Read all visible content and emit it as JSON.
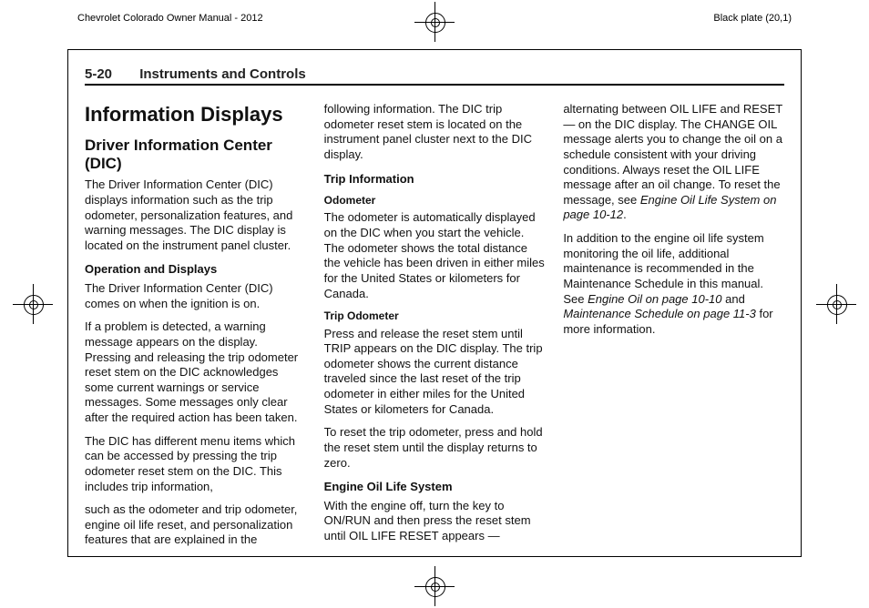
{
  "printer": {
    "left": "Chevrolet Colorado Owner Manual - 2012",
    "right": "Black plate (20,1)"
  },
  "running_head": {
    "page": "5-20",
    "section": "Instruments and Controls"
  },
  "col1": {
    "h1": "Information Displays",
    "h2": "Driver Information Center (DIC)",
    "p1": "The Driver Information Center (DIC) displays information such as the trip odometer, personalization features, and warning messages. The DIC display is located on the instrument panel cluster.",
    "h3a": "Operation and Displays",
    "p2": "The Driver Information Center (DIC) comes on when the ignition is on.",
    "p3": "If a problem is detected, a warning message appears on the display. Pressing and releasing the trip odometer reset stem on the DIC acknowledges some current warnings or service messages. Some messages only clear after the required action has been taken.",
    "p4": "The DIC has different menu items which can be accessed by pressing the trip odometer reset stem on the DIC. This includes trip information,"
  },
  "col2": {
    "p1": "such as the odometer and trip odometer, engine oil life reset, and personalization features that are explained in the following information. The DIC trip odometer reset stem is located on the instrument panel cluster next to the DIC display.",
    "h3a": "Trip Information",
    "h4a": "Odometer",
    "p2": "The odometer is automatically displayed on the DIC when you start the vehicle. The odometer shows the total distance the vehicle has been driven in either miles for the United States or kilometers for Canada.",
    "h4b": "Trip Odometer",
    "p3": "Press and release the reset stem until TRIP appears on the DIC display. The trip odometer shows the current distance traveled since the last reset of the trip odometer in either miles for the United States or kilometers for Canada."
  },
  "col3": {
    "p1": "To reset the trip odometer, press and hold the reset stem until the display returns to zero.",
    "h3a": "Engine Oil Life System",
    "p2a": "With the engine off, turn the key to ON/RUN and then press the reset stem until OIL LIFE RESET appears — alternating between OIL LIFE and RESET — on the DIC display. The CHANGE OIL message alerts you to change the oil on a schedule consistent with your driving conditions. Always reset the OIL LIFE message after an oil change. To reset the message, see ",
    "p2i": "Engine Oil Life System on page 10‑12",
    "p2b": ".",
    "p3a": "In addition to the engine oil life system monitoring the oil life, additional maintenance is recommended in the Maintenance Schedule in this manual. See ",
    "p3i1": "Engine Oil on page 10‑10",
    "p3mid": " and ",
    "p3i2": "Maintenance Schedule on page 11‑3",
    "p3b": " for more information."
  }
}
